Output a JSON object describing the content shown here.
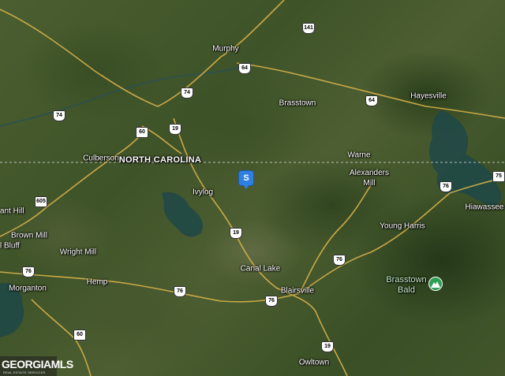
{
  "map": {
    "type": "satellite",
    "state_boundary_label": "NORTH CAROLINA",
    "places": [
      {
        "id": "murphy",
        "name": "Murphy"
      },
      {
        "id": "brasstown",
        "name": "Brasstown"
      },
      {
        "id": "hayesville",
        "name": "Hayesville"
      },
      {
        "id": "culberson",
        "name": "Culberson"
      },
      {
        "id": "warne",
        "name": "Warne"
      },
      {
        "id": "alexanders-mill",
        "name": "Alexanders\nMill"
      },
      {
        "id": "ivylog",
        "name": "Ivylog"
      },
      {
        "id": "hiawassee",
        "name": "Hiawassee"
      },
      {
        "id": "grant-hill",
        "name": "ant Hill"
      },
      {
        "id": "brown-mill",
        "name": "Brown Mill"
      },
      {
        "id": "bluff",
        "name": "l Bluff"
      },
      {
        "id": "wright-mill",
        "name": "Wright Mill"
      },
      {
        "id": "young-harris",
        "name": "Young Harris"
      },
      {
        "id": "canal-lake",
        "name": "Canal Lake"
      },
      {
        "id": "hemp",
        "name": "Hemp"
      },
      {
        "id": "morganton",
        "name": "Morganton"
      },
      {
        "id": "blairsville",
        "name": "Blairsville"
      },
      {
        "id": "owltown",
        "name": "Owltown"
      }
    ],
    "park": {
      "name": "Brasstown Bald",
      "line1": "Brasstown",
      "line2": "Bald",
      "icon": "mountain-icon"
    },
    "highway_shields": [
      "141",
      "64",
      "74",
      "74",
      "60",
      "19",
      "64",
      "605",
      "76",
      "19",
      "76",
      "76",
      "76",
      "76",
      "60",
      "19",
      "75"
    ],
    "listing_pin": {
      "letter": "S",
      "color": "#2f7fe0"
    },
    "logo": {
      "line1": "GEORGIAMLS",
      "line2": "REAL ESTATE SERVICES"
    },
    "colors": {
      "road": "#d8b24a",
      "water": "#1f4a4a",
      "boundary": "#d0d0d0"
    }
  }
}
